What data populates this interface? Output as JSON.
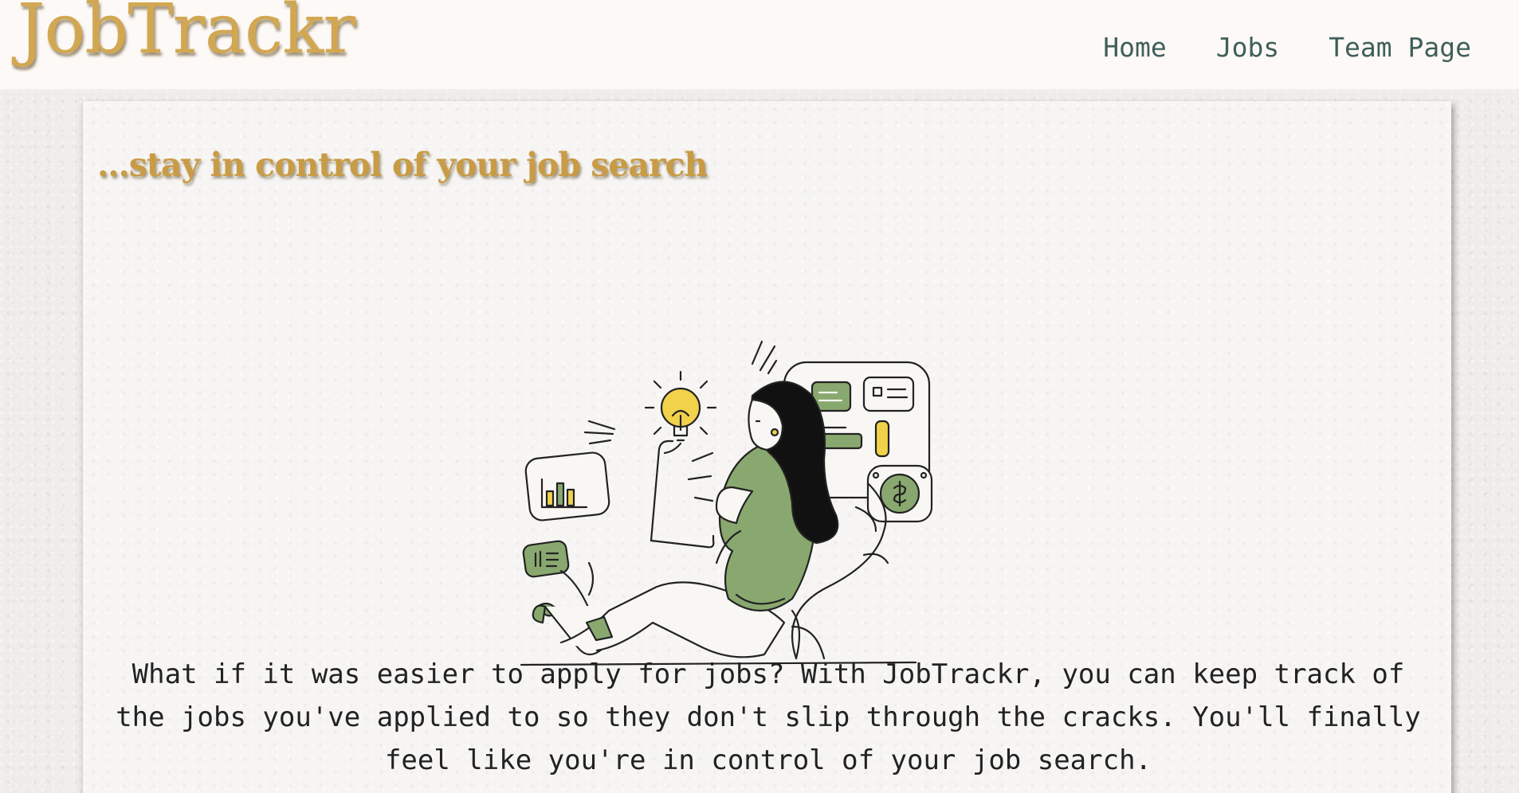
{
  "nav": {
    "brand": "JobTrackr",
    "links": [
      "Home",
      "Jobs",
      "Team Page"
    ]
  },
  "hero": {
    "tagline": "...stay in control of your job search",
    "description": "What if it was easier to apply for jobs? With JobTrackr, you can keep track of the jobs you've applied to so they don't slip through the cracks. You'll finally feel like you're in control of your job search."
  },
  "colors": {
    "brand": "#d2a752",
    "nav_link": "#3f5f5a",
    "accent_green": "#89a86f",
    "accent_yellow": "#f1d24a"
  }
}
